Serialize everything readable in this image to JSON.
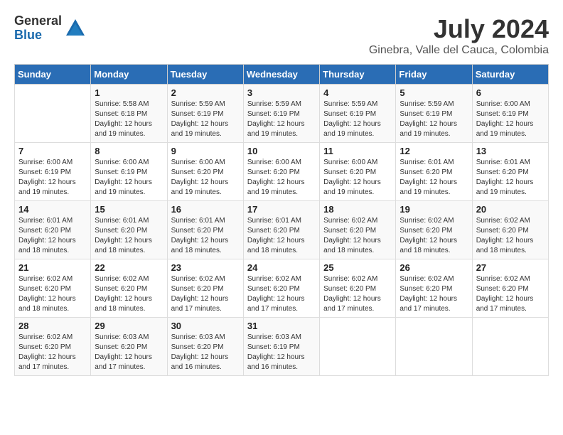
{
  "logo": {
    "general": "General",
    "blue": "Blue"
  },
  "title": "July 2024",
  "subtitle": "Ginebra, Valle del Cauca, Colombia",
  "days_of_week": [
    "Sunday",
    "Monday",
    "Tuesday",
    "Wednesday",
    "Thursday",
    "Friday",
    "Saturday"
  ],
  "weeks": [
    [
      {
        "day": "",
        "info": ""
      },
      {
        "day": "1",
        "info": "Sunrise: 5:58 AM\nSunset: 6:18 PM\nDaylight: 12 hours\nand 19 minutes."
      },
      {
        "day": "2",
        "info": "Sunrise: 5:59 AM\nSunset: 6:19 PM\nDaylight: 12 hours\nand 19 minutes."
      },
      {
        "day": "3",
        "info": "Sunrise: 5:59 AM\nSunset: 6:19 PM\nDaylight: 12 hours\nand 19 minutes."
      },
      {
        "day": "4",
        "info": "Sunrise: 5:59 AM\nSunset: 6:19 PM\nDaylight: 12 hours\nand 19 minutes."
      },
      {
        "day": "5",
        "info": "Sunrise: 5:59 AM\nSunset: 6:19 PM\nDaylight: 12 hours\nand 19 minutes."
      },
      {
        "day": "6",
        "info": "Sunrise: 6:00 AM\nSunset: 6:19 PM\nDaylight: 12 hours\nand 19 minutes."
      }
    ],
    [
      {
        "day": "7",
        "info": "Sunrise: 6:00 AM\nSunset: 6:19 PM\nDaylight: 12 hours\nand 19 minutes."
      },
      {
        "day": "8",
        "info": "Sunrise: 6:00 AM\nSunset: 6:19 PM\nDaylight: 12 hours\nand 19 minutes."
      },
      {
        "day": "9",
        "info": "Sunrise: 6:00 AM\nSunset: 6:20 PM\nDaylight: 12 hours\nand 19 minutes."
      },
      {
        "day": "10",
        "info": "Sunrise: 6:00 AM\nSunset: 6:20 PM\nDaylight: 12 hours\nand 19 minutes."
      },
      {
        "day": "11",
        "info": "Sunrise: 6:00 AM\nSunset: 6:20 PM\nDaylight: 12 hours\nand 19 minutes."
      },
      {
        "day": "12",
        "info": "Sunrise: 6:01 AM\nSunset: 6:20 PM\nDaylight: 12 hours\nand 19 minutes."
      },
      {
        "day": "13",
        "info": "Sunrise: 6:01 AM\nSunset: 6:20 PM\nDaylight: 12 hours\nand 19 minutes."
      }
    ],
    [
      {
        "day": "14",
        "info": "Sunrise: 6:01 AM\nSunset: 6:20 PM\nDaylight: 12 hours\nand 18 minutes."
      },
      {
        "day": "15",
        "info": "Sunrise: 6:01 AM\nSunset: 6:20 PM\nDaylight: 12 hours\nand 18 minutes."
      },
      {
        "day": "16",
        "info": "Sunrise: 6:01 AM\nSunset: 6:20 PM\nDaylight: 12 hours\nand 18 minutes."
      },
      {
        "day": "17",
        "info": "Sunrise: 6:01 AM\nSunset: 6:20 PM\nDaylight: 12 hours\nand 18 minutes."
      },
      {
        "day": "18",
        "info": "Sunrise: 6:02 AM\nSunset: 6:20 PM\nDaylight: 12 hours\nand 18 minutes."
      },
      {
        "day": "19",
        "info": "Sunrise: 6:02 AM\nSunset: 6:20 PM\nDaylight: 12 hours\nand 18 minutes."
      },
      {
        "day": "20",
        "info": "Sunrise: 6:02 AM\nSunset: 6:20 PM\nDaylight: 12 hours\nand 18 minutes."
      }
    ],
    [
      {
        "day": "21",
        "info": "Sunrise: 6:02 AM\nSunset: 6:20 PM\nDaylight: 12 hours\nand 18 minutes."
      },
      {
        "day": "22",
        "info": "Sunrise: 6:02 AM\nSunset: 6:20 PM\nDaylight: 12 hours\nand 18 minutes."
      },
      {
        "day": "23",
        "info": "Sunrise: 6:02 AM\nSunset: 6:20 PM\nDaylight: 12 hours\nand 17 minutes."
      },
      {
        "day": "24",
        "info": "Sunrise: 6:02 AM\nSunset: 6:20 PM\nDaylight: 12 hours\nand 17 minutes."
      },
      {
        "day": "25",
        "info": "Sunrise: 6:02 AM\nSunset: 6:20 PM\nDaylight: 12 hours\nand 17 minutes."
      },
      {
        "day": "26",
        "info": "Sunrise: 6:02 AM\nSunset: 6:20 PM\nDaylight: 12 hours\nand 17 minutes."
      },
      {
        "day": "27",
        "info": "Sunrise: 6:02 AM\nSunset: 6:20 PM\nDaylight: 12 hours\nand 17 minutes."
      }
    ],
    [
      {
        "day": "28",
        "info": "Sunrise: 6:02 AM\nSunset: 6:20 PM\nDaylight: 12 hours\nand 17 minutes."
      },
      {
        "day": "29",
        "info": "Sunrise: 6:03 AM\nSunset: 6:20 PM\nDaylight: 12 hours\nand 17 minutes."
      },
      {
        "day": "30",
        "info": "Sunrise: 6:03 AM\nSunset: 6:20 PM\nDaylight: 12 hours\nand 16 minutes."
      },
      {
        "day": "31",
        "info": "Sunrise: 6:03 AM\nSunset: 6:19 PM\nDaylight: 12 hours\nand 16 minutes."
      },
      {
        "day": "",
        "info": ""
      },
      {
        "day": "",
        "info": ""
      },
      {
        "day": "",
        "info": ""
      }
    ]
  ]
}
